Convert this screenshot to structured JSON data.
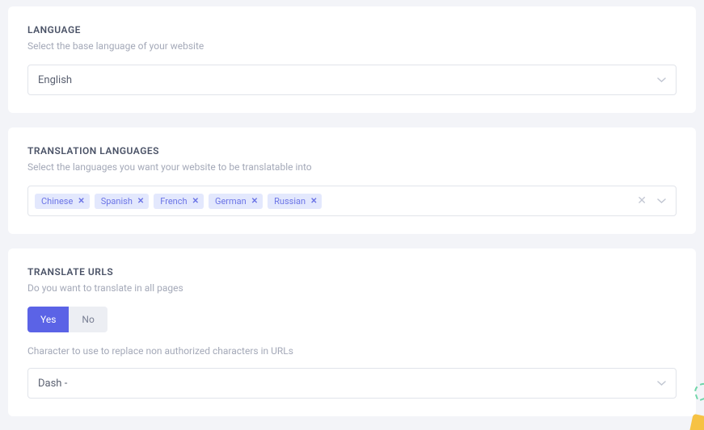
{
  "language": {
    "title": "LANGUAGE",
    "desc": "Select the base language of your website",
    "selected": "English"
  },
  "translation": {
    "title": "TRANSLATION LANGUAGES",
    "desc": "Select the languages you want your website to be translatable into",
    "tags": [
      "Chinese",
      "Spanish",
      "French",
      "German",
      "Russian"
    ]
  },
  "translate_urls": {
    "title": "TRANSLATE URLS",
    "desc": "Do you want to translate in all pages",
    "yes": "Yes",
    "no": "No",
    "char_desc": "Character to use to replace non authorized characters in URLs",
    "char_selected": "Dash -"
  }
}
